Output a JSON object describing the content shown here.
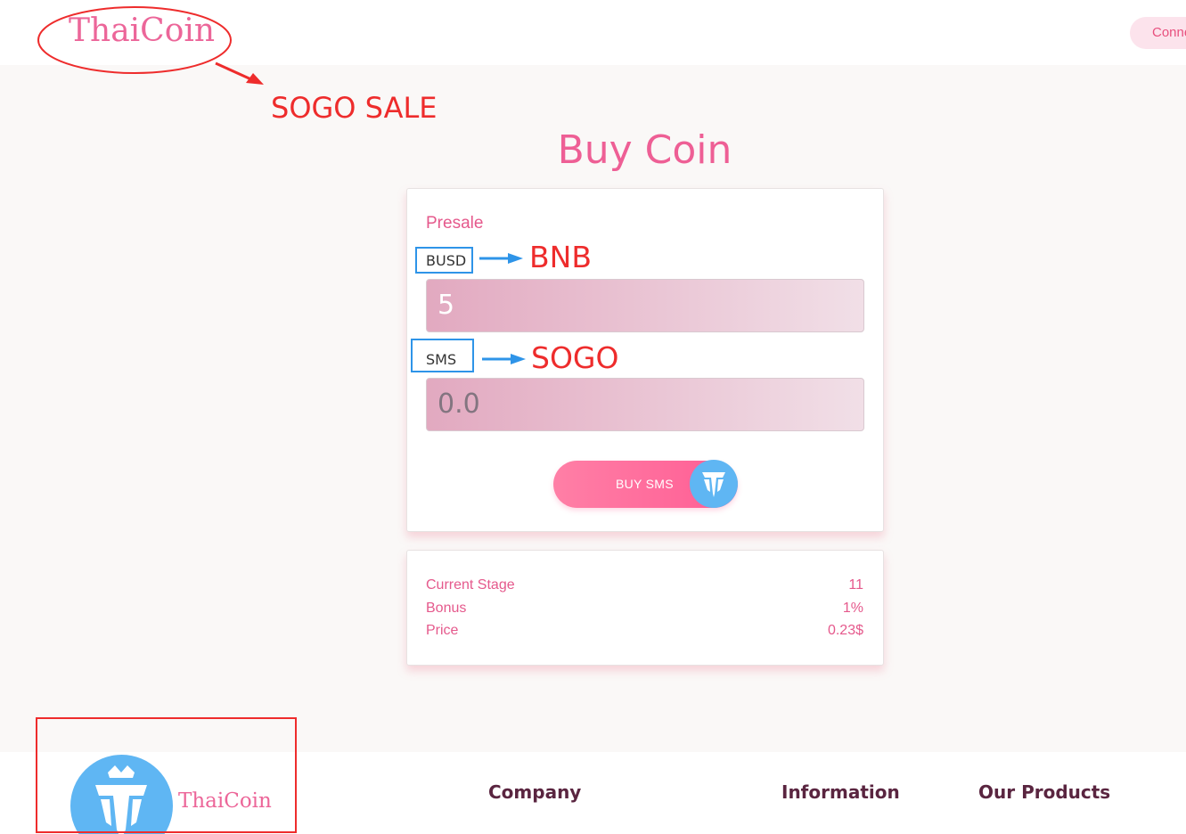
{
  "header": {
    "logo_text": "ThaiCoin",
    "connect_label": "Connect"
  },
  "main": {
    "title": "Buy Coin",
    "presale_label": "Presale",
    "busd_label": "BUSD",
    "busd_value": "5",
    "sms_label": "SMS",
    "sms_value": "0.0",
    "buy_button_label": "BUY SMS",
    "info": [
      {
        "label": "Current Stage",
        "value": "11"
      },
      {
        "label": "Bonus",
        "value": "1%"
      },
      {
        "label": "Price",
        "value": "0.23$"
      }
    ]
  },
  "footer": {
    "brand": "ThaiCoin",
    "columns": [
      "Company",
      "Information",
      "Our Products"
    ]
  },
  "annotations": {
    "sale_note": "SOGO SALE",
    "busd_replacement": "BNB",
    "sms_replacement": "SOGO",
    "colors": {
      "red": "#ee2c2c",
      "blue": "#2e94e8"
    }
  },
  "icons": {
    "brand_logo": "crown-shield-icon"
  }
}
